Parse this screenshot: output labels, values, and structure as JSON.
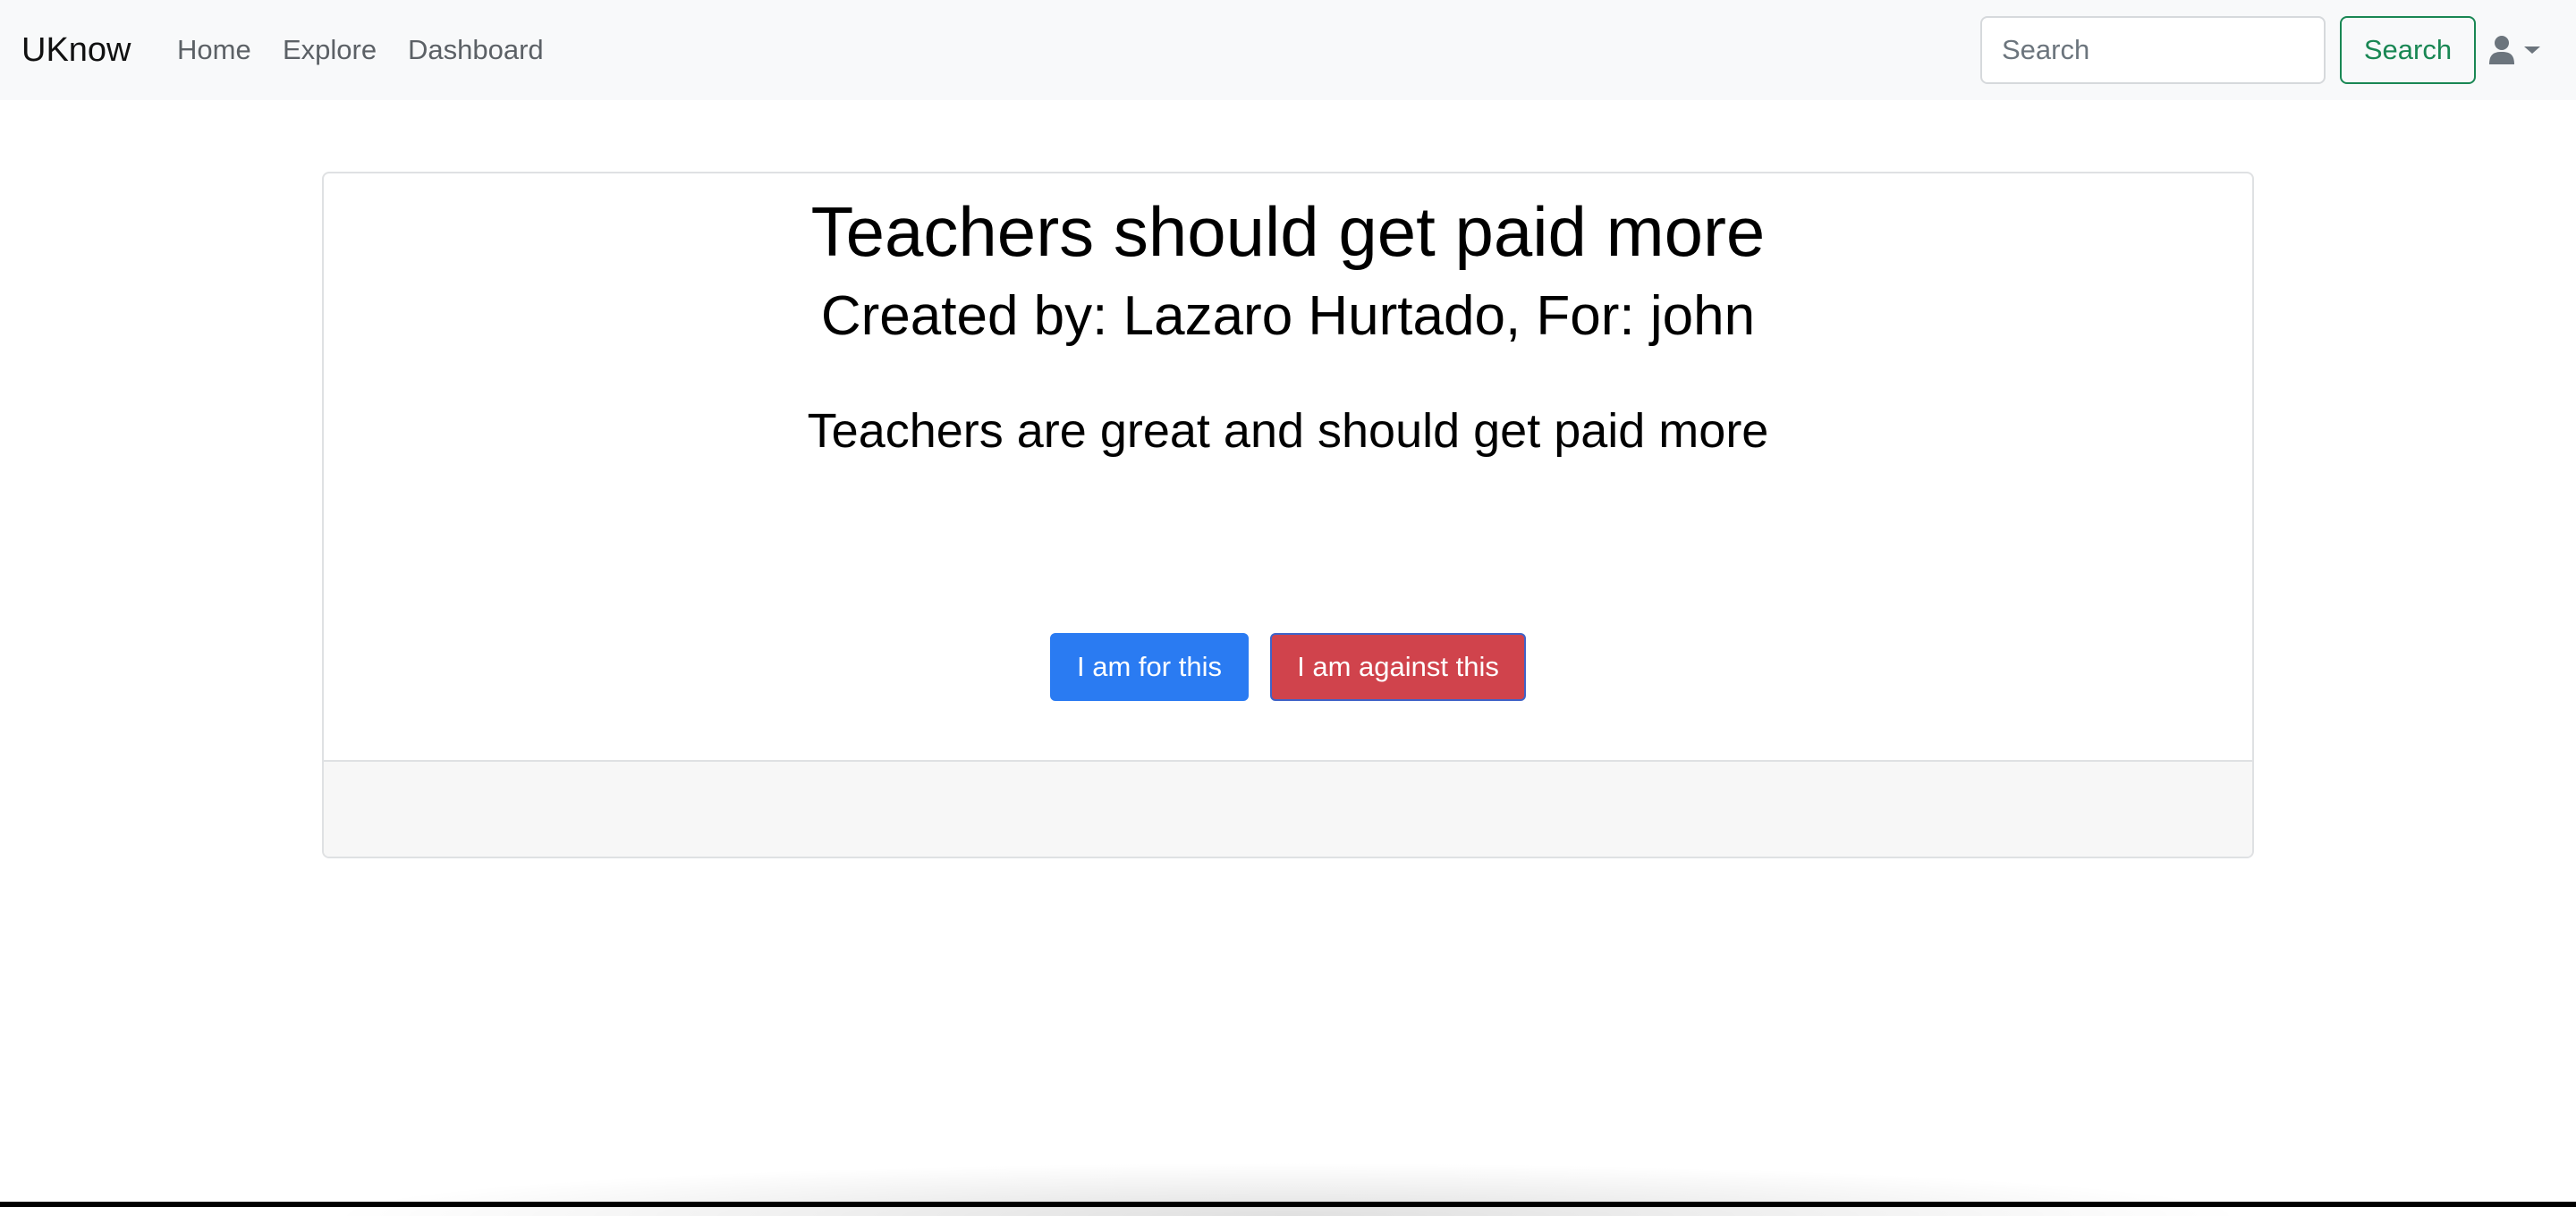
{
  "navbar": {
    "brand": "UKnow",
    "links": [
      {
        "label": "Home"
      },
      {
        "label": "Explore"
      },
      {
        "label": "Dashboard"
      }
    ],
    "search": {
      "placeholder": "Search",
      "button_label": "Search"
    },
    "user_menu": {
      "icon": "user-icon",
      "caret": "caret-down-icon"
    }
  },
  "post": {
    "title": "Teachers should get paid more",
    "subtitle": "Created by: Lazaro Hurtado, For: john",
    "body": "Teachers are great and should get paid more",
    "actions": {
      "for_label": "I am for this",
      "against_label": "I am against this"
    }
  },
  "colors": {
    "navbar_bg": "#f8f9fa",
    "success": "#198754",
    "primary": "#2a7bf2",
    "danger": "#d0434c"
  }
}
